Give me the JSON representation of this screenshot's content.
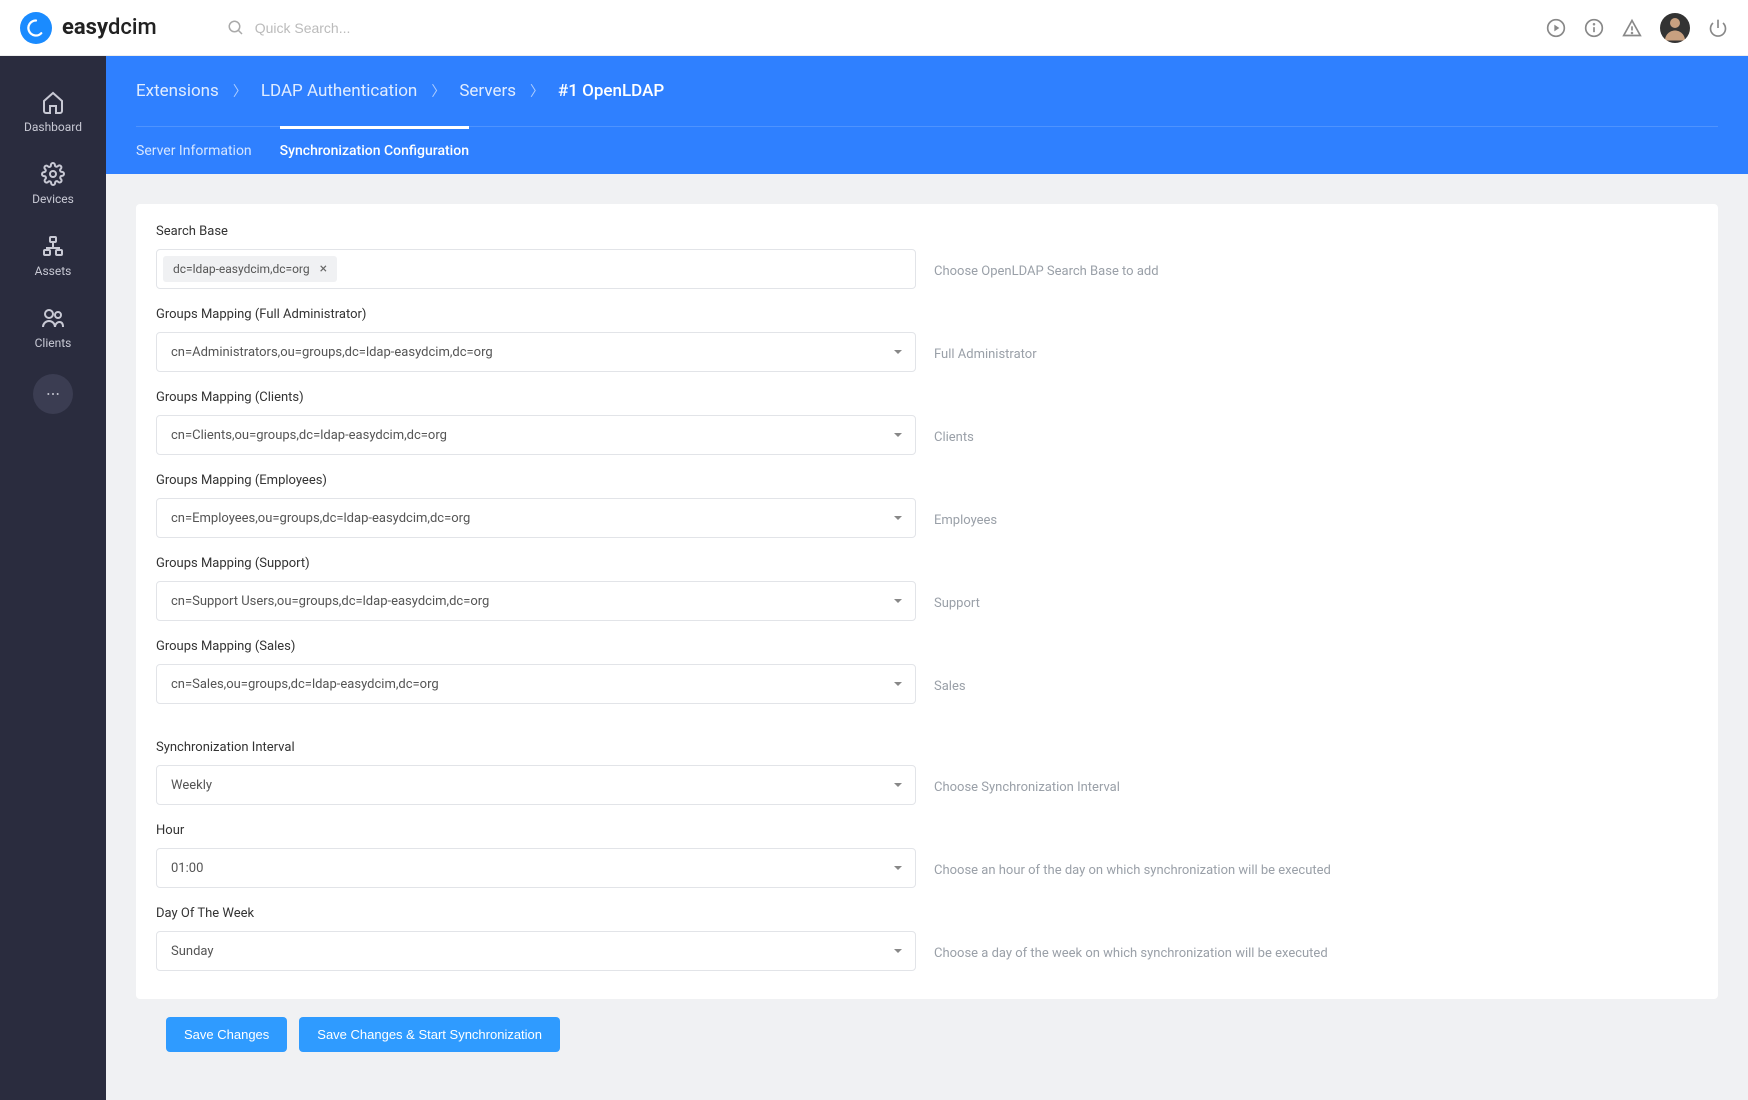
{
  "app": {
    "name1": "easy",
    "name2": "dcim"
  },
  "search": {
    "placeholder": "Quick Search..."
  },
  "sidebar": {
    "items": [
      {
        "label": "Dashboard"
      },
      {
        "label": "Devices"
      },
      {
        "label": "Assets"
      },
      {
        "label": "Clients"
      }
    ]
  },
  "breadcrumb": {
    "items": [
      "Extensions",
      "LDAP Authentication",
      "Servers",
      "#1 OpenLDAP"
    ]
  },
  "tabs": [
    {
      "label": "Server Information",
      "active": false
    },
    {
      "label": "Synchronization Configuration",
      "active": true
    }
  ],
  "form": {
    "search_base": {
      "label": "Search Base",
      "tag": "dc=ldap-easydcim,dc=org",
      "help": "Choose OpenLDAP Search Base to add"
    },
    "groups": [
      {
        "label": "Groups Mapping (Full Administrator)",
        "value": "cn=Administrators,ou=groups,dc=ldap-easydcim,dc=org",
        "help": "Full Administrator"
      },
      {
        "label": "Groups Mapping (Clients)",
        "value": "cn=Clients,ou=groups,dc=ldap-easydcim,dc=org",
        "help": "Clients"
      },
      {
        "label": "Groups Mapping (Employees)",
        "value": "cn=Employees,ou=groups,dc=ldap-easydcim,dc=org",
        "help": "Employees"
      },
      {
        "label": "Groups Mapping (Support)",
        "value": "cn=Support Users,ou=groups,dc=ldap-easydcim,dc=org",
        "help": "Support"
      },
      {
        "label": "Groups Mapping (Sales)",
        "value": "cn=Sales,ou=groups,dc=ldap-easydcim,dc=org",
        "help": "Sales"
      }
    ],
    "sync_interval": {
      "label": "Synchronization Interval",
      "value": "Weekly",
      "help": "Choose Synchronization Interval"
    },
    "hour": {
      "label": "Hour",
      "value": "01:00",
      "help": "Choose an hour of the day on which synchronization will be executed"
    },
    "day_of_week": {
      "label": "Day Of The Week",
      "value": "Sunday",
      "help": "Choose a day of the week on which synchronization will be executed"
    }
  },
  "buttons": {
    "save": "Save Changes",
    "save_sync": "Save Changes & Start Synchronization"
  }
}
